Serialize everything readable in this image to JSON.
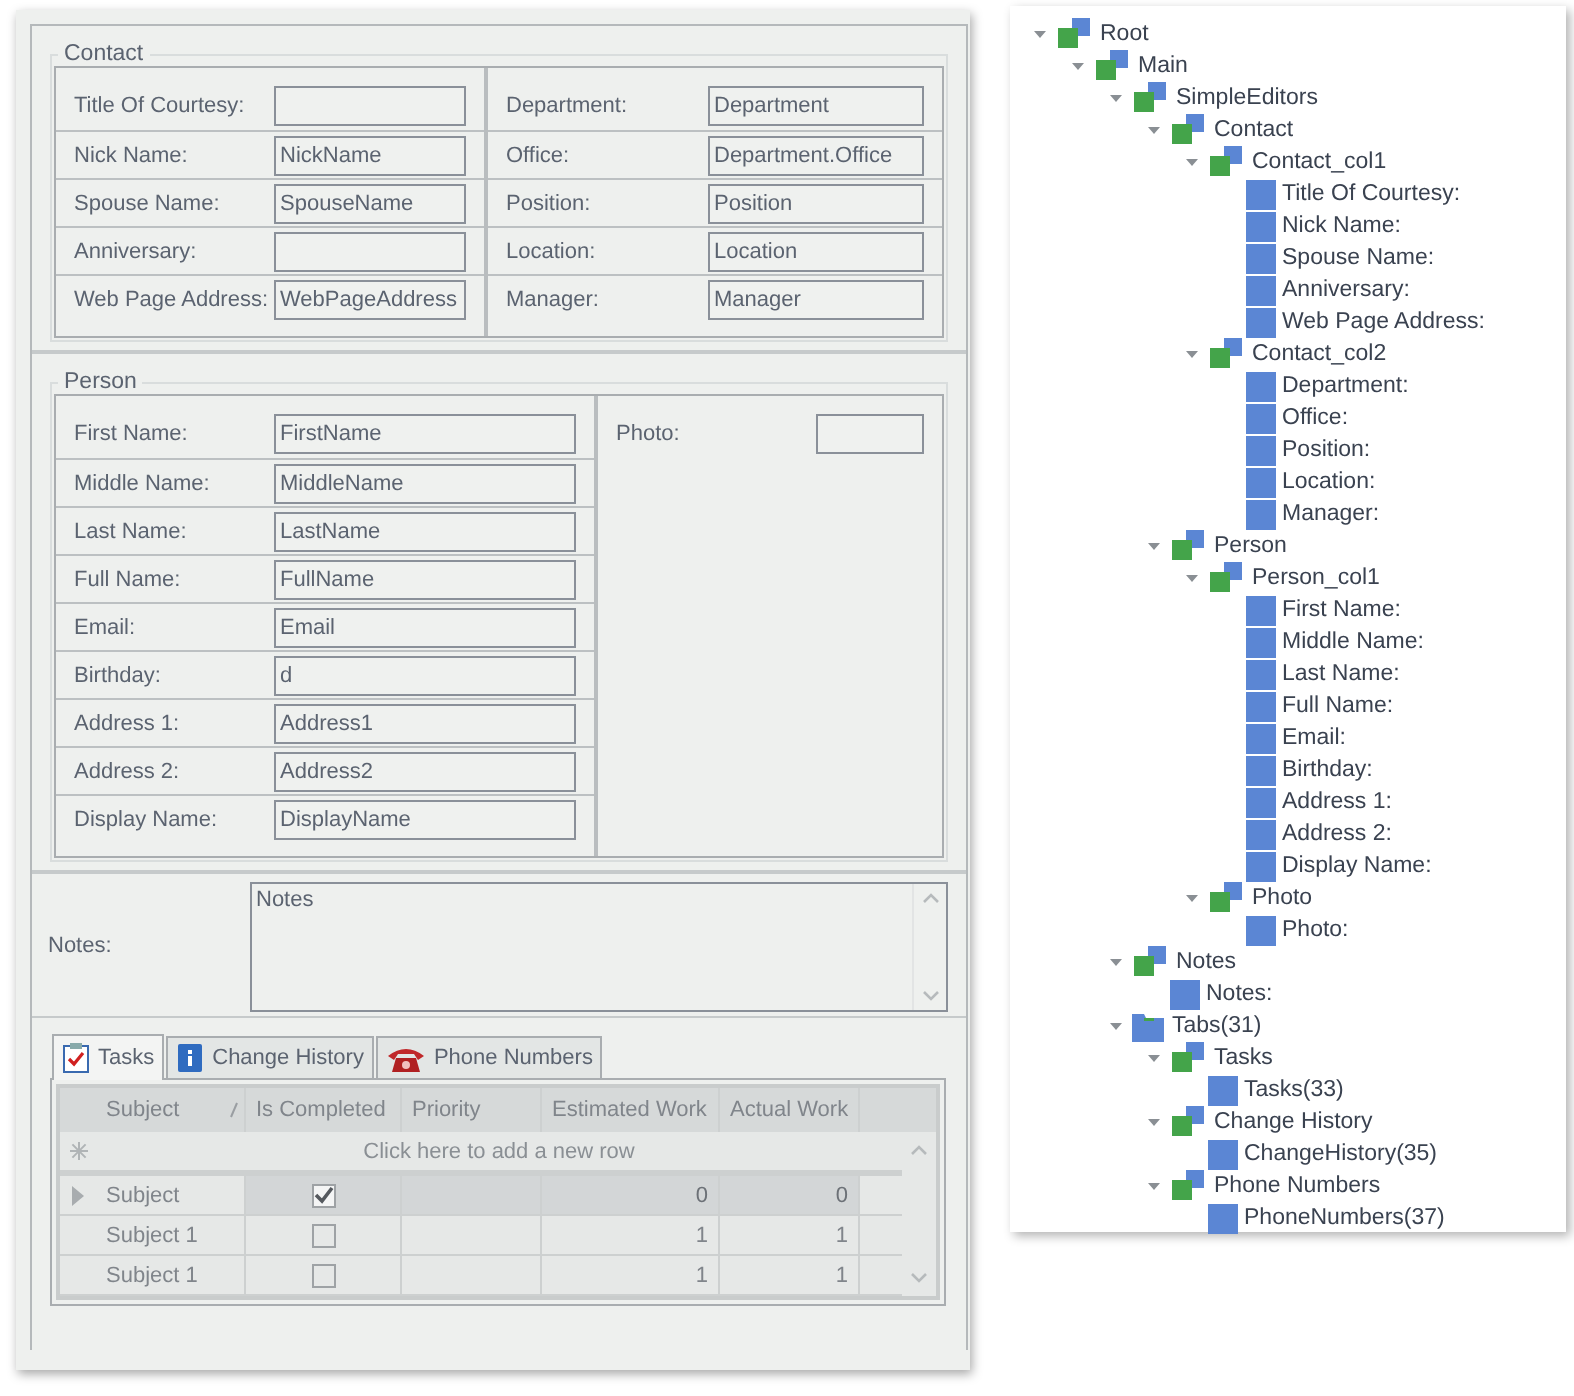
{
  "contact": {
    "caption": "Contact",
    "col1": [
      {
        "label": "Title Of Courtesy:"
      },
      {
        "label": "Nick Name:",
        "value": "NickName"
      },
      {
        "label": "Spouse Name:",
        "value": "SpouseName"
      },
      {
        "label": "Anniversary:"
      },
      {
        "label": "Web Page Address:",
        "value": "WebPageAddress"
      }
    ],
    "col2": [
      {
        "label": "Department:",
        "value": "Department"
      },
      {
        "label": "Office:",
        "value": "Department.Office"
      },
      {
        "label": "Position:",
        "value": "Position"
      },
      {
        "label": "Location:",
        "value": "Location"
      },
      {
        "label": "Manager:",
        "value": "Manager"
      }
    ]
  },
  "person": {
    "caption": "Person",
    "col1": [
      {
        "label": "First Name:",
        "value": "FirstName"
      },
      {
        "label": "Middle Name:",
        "value": "MiddleName"
      },
      {
        "label": "Last Name:",
        "value": "LastName"
      },
      {
        "label": "Full Name:",
        "value": "FullName"
      },
      {
        "label": "Email:",
        "value": "Email"
      },
      {
        "label": "Birthday:",
        "value": "d"
      },
      {
        "label": "Address 1:",
        "value": "Address1"
      },
      {
        "label": "Address 2:",
        "value": "Address2"
      },
      {
        "label": "Display Name:",
        "value": "DisplayName"
      }
    ],
    "photo": {
      "label": "Photo:"
    }
  },
  "notes": {
    "label": "Notes:",
    "value": "Notes"
  },
  "tabs": [
    {
      "label": "Tasks",
      "selected": true
    },
    {
      "label": "Change History",
      "selected": false
    },
    {
      "label": "Phone Numbers",
      "selected": false
    }
  ],
  "grid": {
    "columns": [
      {
        "label": "Subject",
        "sorted": true
      },
      {
        "label": "Is Completed",
        "sorted": false
      },
      {
        "label": "Priority",
        "sorted": false
      },
      {
        "label": "Estimated Work",
        "sorted": false
      },
      {
        "label": "Actual Work",
        "sorted": false
      }
    ],
    "new_row": "Click here to add a new row",
    "rows": [
      {
        "subject": "Subject",
        "completed": true,
        "estimated_work": "0",
        "actual_work": "0",
        "selected": true
      },
      {
        "subject": "Subject 1",
        "completed": false,
        "estimated_work": "1",
        "actual_work": "1",
        "selected": false
      },
      {
        "subject": "Subject 1",
        "completed": false,
        "estimated_work": "1",
        "actual_work": "1",
        "selected": false
      }
    ]
  },
  "tree": [
    {
      "label": "Root",
      "kind": "group",
      "expanded": true,
      "children": [
        {
          "label": "Main",
          "kind": "group",
          "expanded": true,
          "children": [
            {
              "label": "SimpleEditors",
              "kind": "group",
              "expanded": true,
              "children": [
                {
                  "label": "Contact",
                  "kind": "group",
                  "expanded": true,
                  "children": [
                    {
                      "label": "Contact_col1",
                      "kind": "group",
                      "expanded": true,
                      "children": [
                        {
                          "label": "Title Of Courtesy:",
                          "kind": "item"
                        },
                        {
                          "label": "Nick Name:",
                          "kind": "item"
                        },
                        {
                          "label": "Spouse Name:",
                          "kind": "item"
                        },
                        {
                          "label": "Anniversary:",
                          "kind": "item"
                        },
                        {
                          "label": "Web Page Address:",
                          "kind": "item"
                        }
                      ]
                    },
                    {
                      "label": "Contact_col2",
                      "kind": "group",
                      "expanded": true,
                      "children": [
                        {
                          "label": "Department:",
                          "kind": "item"
                        },
                        {
                          "label": "Office:",
                          "kind": "item"
                        },
                        {
                          "label": "Position:",
                          "kind": "item"
                        },
                        {
                          "label": "Location:",
                          "kind": "item"
                        },
                        {
                          "label": "Manager:",
                          "kind": "item"
                        }
                      ]
                    }
                  ]
                },
                {
                  "label": "Person",
                  "kind": "group",
                  "expanded": true,
                  "children": [
                    {
                      "label": "Person_col1",
                      "kind": "group",
                      "expanded": true,
                      "children": [
                        {
                          "label": "First Name:",
                          "kind": "item"
                        },
                        {
                          "label": "Middle Name:",
                          "kind": "item"
                        },
                        {
                          "label": "Last Name:",
                          "kind": "item"
                        },
                        {
                          "label": "Full Name:",
                          "kind": "item"
                        },
                        {
                          "label": "Email:",
                          "kind": "item"
                        },
                        {
                          "label": "Birthday:",
                          "kind": "item"
                        },
                        {
                          "label": "Address 1:",
                          "kind": "item"
                        },
                        {
                          "label": "Address 2:",
                          "kind": "item"
                        },
                        {
                          "label": "Display Name:",
                          "kind": "item"
                        }
                      ]
                    },
                    {
                      "label": "Photo",
                      "kind": "group",
                      "expanded": true,
                      "children": [
                        {
                          "label": "Photo:",
                          "kind": "item"
                        }
                      ]
                    }
                  ]
                }
              ]
            },
            {
              "label": "Notes",
              "kind": "group",
              "expanded": true,
              "children": [
                {
                  "label": "Notes:",
                  "kind": "item"
                }
              ]
            },
            {
              "label": "Tabs(31)",
              "kind": "tabs",
              "expanded": true,
              "children": [
                {
                  "label": "Tasks",
                  "kind": "group",
                  "expanded": true,
                  "children": [
                    {
                      "label": "Tasks(33)",
                      "kind": "item"
                    }
                  ]
                },
                {
                  "label": "Change History",
                  "kind": "group",
                  "expanded": true,
                  "children": [
                    {
                      "label": "ChangeHistory(35)",
                      "kind": "item"
                    }
                  ]
                },
                {
                  "label": "Phone Numbers",
                  "kind": "group",
                  "expanded": true,
                  "children": [
                    {
                      "label": "PhoneNumbers(37)",
                      "kind": "item"
                    }
                  ]
                }
              ]
            }
          ]
        }
      ]
    }
  ]
}
